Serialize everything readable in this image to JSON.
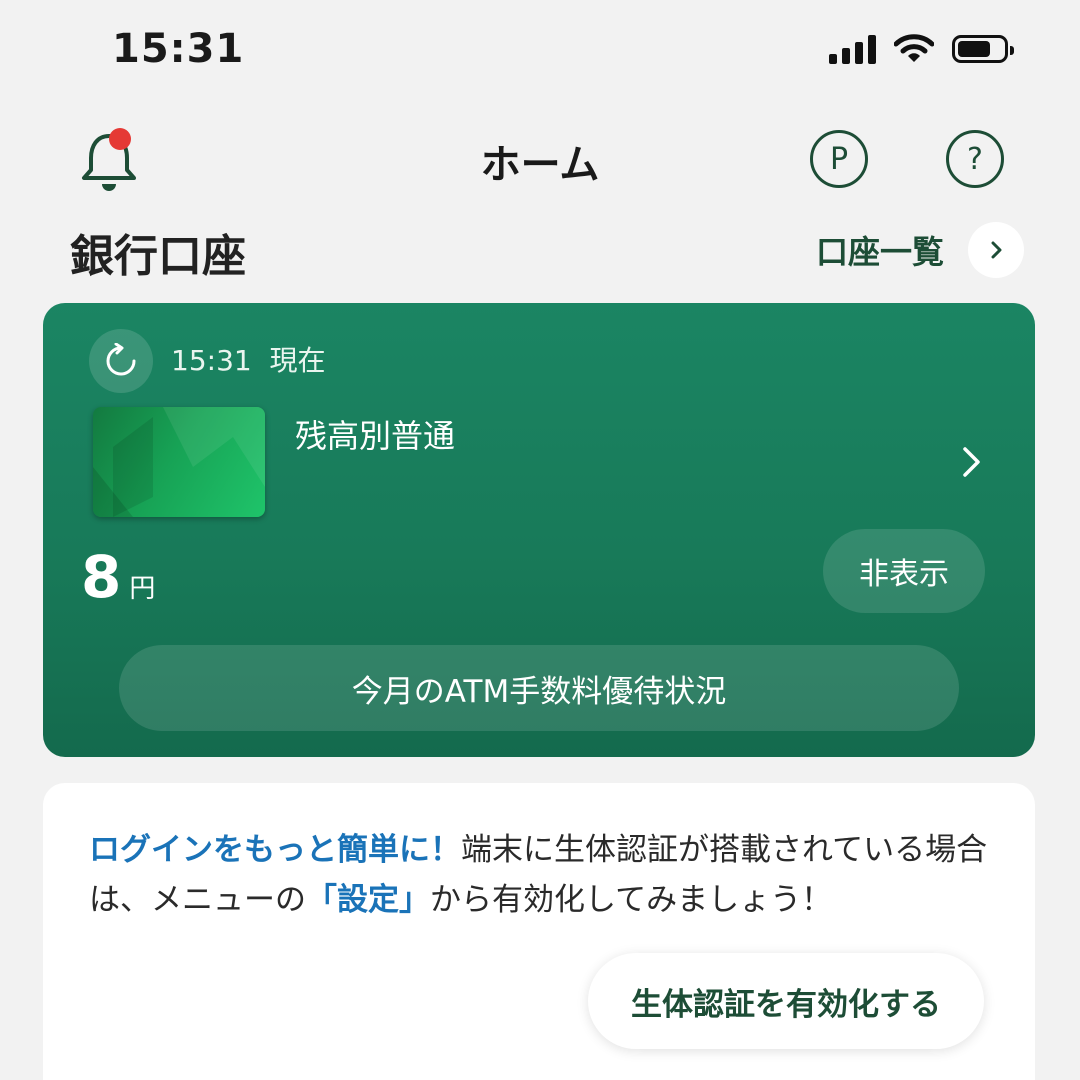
{
  "status_bar": {
    "time": "15:31",
    "signal_icon": "signal-bars-icon",
    "wifi_icon": "wifi-icon",
    "battery_level": 0.7
  },
  "header": {
    "title": "ホーム",
    "bell_icon": "bell-icon",
    "notification_dot_color": "#e53935",
    "points_button_label": "P",
    "help_button_label": "?"
  },
  "section": {
    "title": "銀行口座",
    "account_list_label": "口座一覧"
  },
  "account_card": {
    "update_time": "15:31",
    "update_suffix": "現在",
    "account_name": "残高別普通",
    "balance": "8",
    "currency": "円",
    "hide_label": "非表示",
    "atm_label": "今月のATM手数料優待状況",
    "background_color": "#187a59"
  },
  "info_card": {
    "highlight_title": "ログインをもっと簡単に！",
    "body_1": "端末に生体認証が搭載されている場合は、メニューの",
    "highlight_settings": "「設定」",
    "body_2": "から有効化してみましょう！",
    "enable_button_label": "生体認証を有効化する",
    "highlight_color": "#1a73b8"
  }
}
